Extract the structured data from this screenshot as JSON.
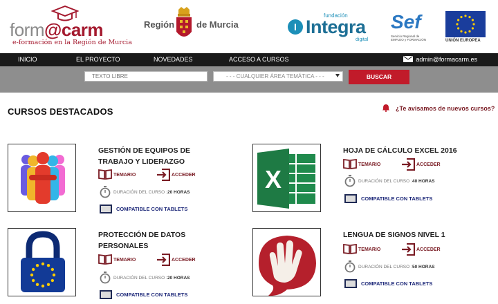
{
  "header": {
    "formacarm": {
      "form": "form",
      "at": "@",
      "carm": "carm",
      "tagline": "e-formación en la Región de Murcia"
    },
    "region": {
      "left": "Región",
      "right": "de Murcia"
    },
    "integra": {
      "fundacion": "fundación",
      "letter": "I",
      "word": "Integra",
      "digital": "digital"
    },
    "sef": {
      "word": "Sef",
      "sub": "Servicio Regional de EMPLEO y FORMACIÓN"
    },
    "eu": {
      "label": "UNIÓN EUROPEA"
    }
  },
  "nav": {
    "items": [
      "INICIO",
      "EL PROYECTO",
      "NOVEDADES",
      "ACCESO A CURSOS"
    ],
    "email": "admin@formacarm.es"
  },
  "search": {
    "placeholder": "TEXTO LIBRE",
    "area_selected": "- - - CUALQUIER ÁREA TEMÁTICA - - -",
    "button": "BUSCAR"
  },
  "section": {
    "title": "CURSOS DESTACADOS",
    "notify": "¿Te avisamos de nuevos cursos?"
  },
  "labels": {
    "temario": "TEMARIO",
    "acceder": "ACCEDER",
    "duracion": "DURACIÓN DEL CURSO :",
    "tablets": "COMPATIBLE CON TABLETS"
  },
  "courses": [
    {
      "title_line1": "GESTIÓN DE EQUIPOS DE",
      "title_line2": "TRABAJO Y LIDERAZGO",
      "hours": "20 HORAS",
      "thumb": "team-figures-image"
    },
    {
      "title_line1": "HOJA DE CÁLCULO EXCEL 2016",
      "title_line2": "",
      "hours": "40 HORAS",
      "thumb": "excel-logo-image"
    },
    {
      "title_line1": "PROTECCIÓN DE DATOS",
      "title_line2": "PERSONALES",
      "hours": "20 HORAS",
      "thumb": "eu-padlock-image"
    },
    {
      "title_line1": "LENGUA DE SIGNOS NIVEL 1",
      "title_line2": "",
      "hours": "50 HORAS",
      "thumb": "signing-hands-image"
    }
  ],
  "colors": {
    "brand_red": "#a4192e",
    "button_red": "#c11b2a",
    "nav_bg": "#1a1a1a",
    "search_bg": "#8e8e8e"
  }
}
